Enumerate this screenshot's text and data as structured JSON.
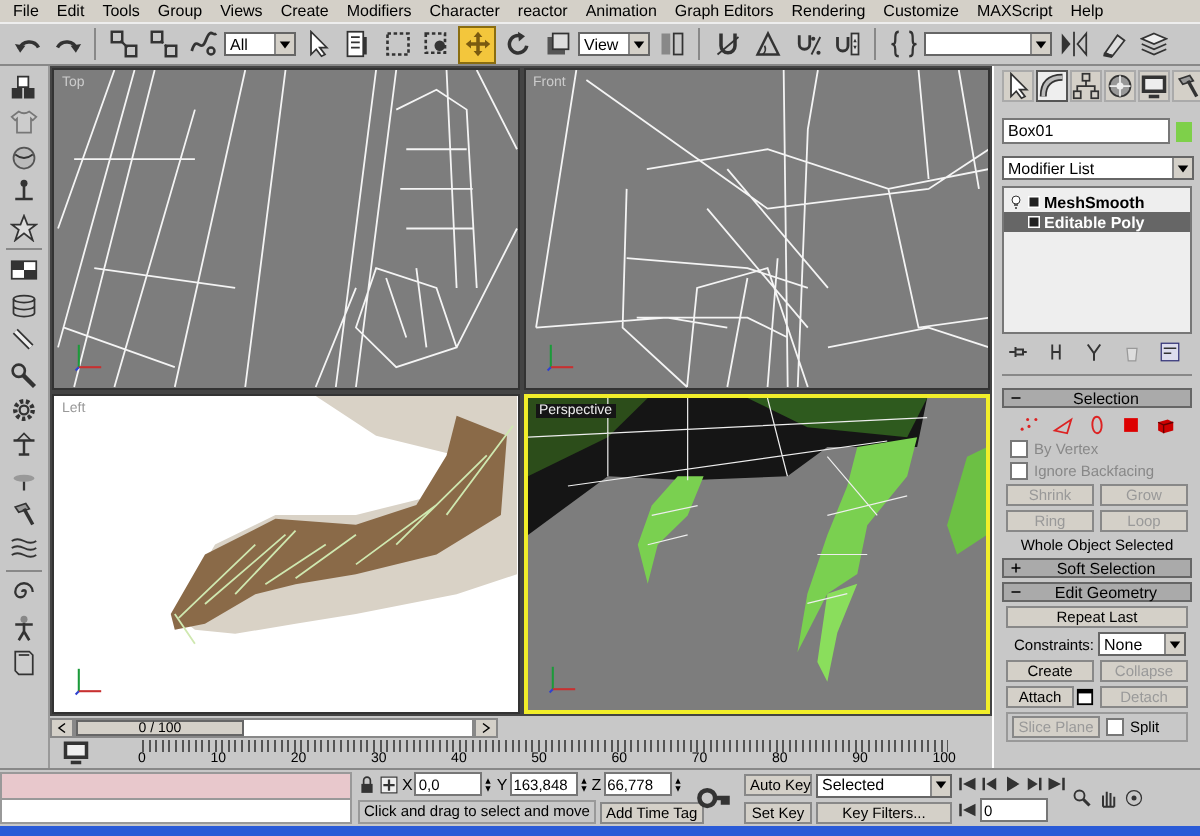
{
  "menu": [
    "File",
    "Edit",
    "Tools",
    "Group",
    "Views",
    "Create",
    "Modifiers",
    "Character",
    "reactor",
    "Animation",
    "Graph Editors",
    "Rendering",
    "Customize",
    "MAXScript",
    "Help"
  ],
  "toolbar": [
    {
      "kind": "button",
      "selected": false
    },
    {
      "kind": "button",
      "selected": false
    },
    {
      "kind": "divider"
    },
    {
      "kind": "button",
      "selected": false
    },
    {
      "kind": "button",
      "selected": false
    },
    {
      "kind": "button",
      "selected": false
    },
    {
      "kind": "dropdown",
      "value": "All"
    },
    {
      "kind": "button",
      "selected": false
    },
    {
      "kind": "button",
      "selected": false
    },
    {
      "kind": "button",
      "selected": false
    },
    {
      "kind": "button",
      "selected": false
    },
    {
      "kind": "button",
      "selected": true
    },
    {
      "kind": "button",
      "selected": false
    },
    {
      "kind": "button",
      "selected": false
    },
    {
      "kind": "dropdown",
      "value": "View"
    },
    {
      "kind": "button",
      "selected": false
    },
    {
      "kind": "divider"
    },
    {
      "kind": "button",
      "selected": false
    },
    {
      "kind": "button",
      "selected": false
    },
    {
      "kind": "button",
      "selected": false
    },
    {
      "kind": "button",
      "selected": false
    },
    {
      "kind": "divider"
    },
    {
      "kind": "button",
      "selected": false
    },
    {
      "kind": "dropdown"
    },
    {
      "kind": "button",
      "selected": false
    },
    {
      "kind": "button",
      "selected": false
    },
    {
      "kind": "button",
      "selected": false
    }
  ],
  "viewports": [
    {
      "label": "Top",
      "active": false,
      "kind": "top"
    },
    {
      "label": "Front",
      "active": false,
      "kind": "front"
    },
    {
      "label": "Left",
      "active": false,
      "kind": "left"
    },
    {
      "label": "Perspective",
      "active": true,
      "kind": "perspective"
    }
  ],
  "command_panel": {
    "tabs": [
      {
        "selected": false
      },
      {
        "selected": true
      },
      {
        "selected": false
      },
      {
        "selected": false
      },
      {
        "selected": false
      },
      {
        "selected": false
      }
    ],
    "object_name": "Box01",
    "modifier_list": "Modifier List",
    "stack": [
      {
        "label": "MeshSmooth",
        "kind": "modifier",
        "selected": false
      },
      {
        "label": "Editable Poly",
        "kind": "base",
        "selected": true
      }
    ],
    "selection": {
      "title": "Selection",
      "expanded": true,
      "levels": [
        {
          "selected": false
        },
        {
          "selected": false
        },
        {
          "selected": false
        },
        {
          "selected": false
        },
        {
          "selected": false
        }
      ],
      "checkboxes": [
        {
          "label": "By Vertex",
          "checked": false,
          "disabled": true
        },
        {
          "label": "Ignore Backfacing",
          "checked": false,
          "disabled": true
        }
      ],
      "buttons": [
        {
          "label": "Shrink",
          "disabled": true
        },
        {
          "label": "Grow",
          "disabled": true
        },
        {
          "label": "Ring",
          "disabled": true
        },
        {
          "label": "Loop",
          "disabled": true
        }
      ],
      "status": "Whole Object Selected"
    },
    "soft_selection": {
      "title": "Soft Selection",
      "expanded": false
    },
    "edit_geometry": {
      "title": "Edit Geometry",
      "expanded": true,
      "repeat_last": "Repeat Last",
      "constraints_label": "Constraints:",
      "constraints_value": "None",
      "buttons": [
        {
          "label": "Create",
          "disabled": false
        },
        {
          "label": "Collapse",
          "disabled": true
        },
        {
          "label": "Attach",
          "disabled": false
        },
        {
          "label": "Detach",
          "disabled": true
        }
      ],
      "slice_plane": {
        "label": "Slice Plane",
        "disabled": true
      },
      "split": {
        "label": "Split",
        "checked": false
      }
    }
  },
  "time_slider": {
    "label": "0 / 100"
  },
  "track_labels": [
    "0",
    "10",
    "20",
    "30",
    "40",
    "50",
    "60",
    "70",
    "80",
    "90",
    "100"
  ],
  "status_bar": {
    "coords": [
      {
        "axis": "X",
        "value": "0,0"
      },
      {
        "axis": "Y",
        "value": "163,848"
      },
      {
        "axis": "Z",
        "value": "66,778"
      }
    ],
    "prompt": "Click and drag to select and move",
    "add_time_tag": "Add Time Tag",
    "auto_key": {
      "label": "Auto Key",
      "on": false
    },
    "set_key": "Set Key",
    "key_mode": "Selected",
    "key_filters": "Key Filters...",
    "current_frame": "0"
  }
}
